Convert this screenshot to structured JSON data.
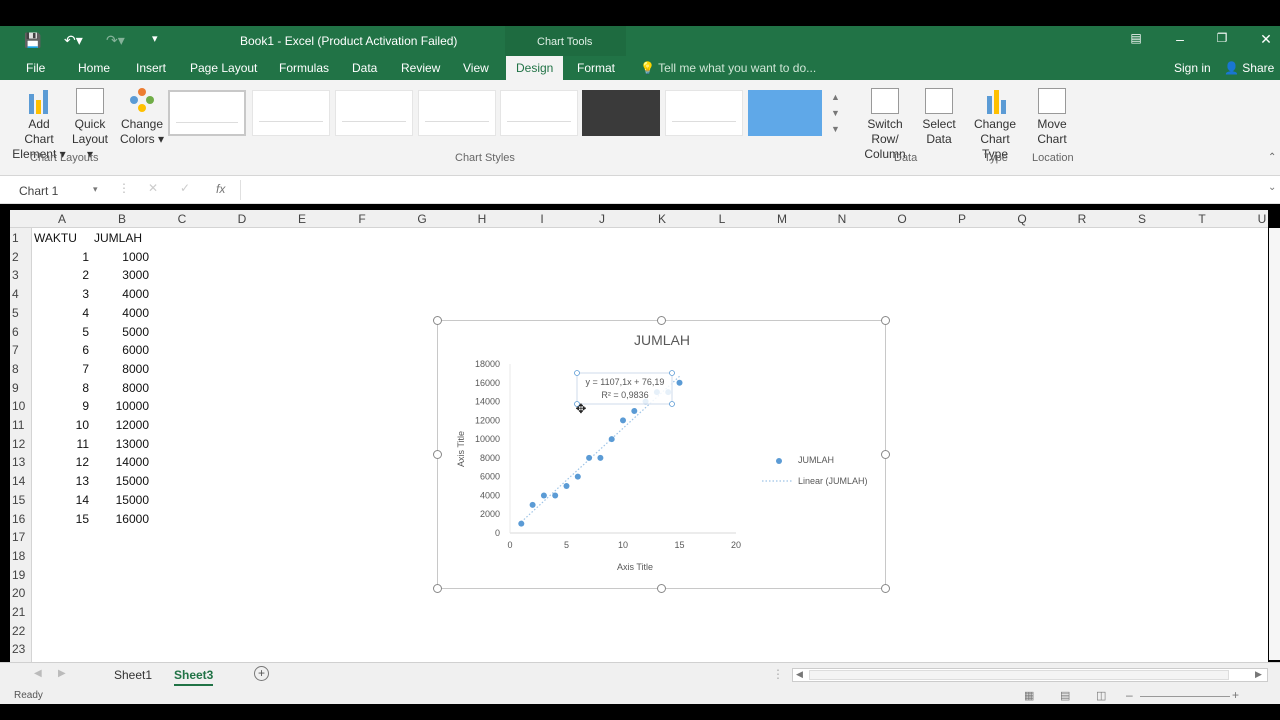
{
  "window": {
    "title": "Book1 - Excel (Product Activation Failed)",
    "context_tab_group": "Chart Tools"
  },
  "tabs": [
    "File",
    "Home",
    "Insert",
    "Page Layout",
    "Formulas",
    "Data",
    "Review",
    "View",
    "Design",
    "Format"
  ],
  "active_tab": "Design",
  "tell_me": "Tell me what you want to do...",
  "account": {
    "signin": "Sign in",
    "share": "Share"
  },
  "ribbon": {
    "add_chart_element": [
      "Add Chart",
      "Element"
    ],
    "quick_layout": [
      "Quick",
      "Layout"
    ],
    "change_colors": [
      "Change",
      "Colors"
    ],
    "switch_row_column": [
      "Switch Row/",
      "Column"
    ],
    "select_data": [
      "Select",
      "Data"
    ],
    "change_chart_type": [
      "Change",
      "Chart Type"
    ],
    "move_chart": [
      "Move",
      "Chart"
    ],
    "groups": {
      "chart_layouts": "Chart Layouts",
      "chart_styles": "Chart Styles",
      "data": "Data",
      "type": "Type",
      "location": "Location"
    }
  },
  "name_box": "Chart 1",
  "fx": "fx",
  "columns": [
    "A",
    "B",
    "C",
    "D",
    "E",
    "F",
    "G",
    "H",
    "I",
    "J",
    "K",
    "L",
    "M",
    "N",
    "O",
    "P",
    "Q",
    "R",
    "S",
    "T",
    "U"
  ],
  "rows": [
    "1",
    "2",
    "3",
    "4",
    "5",
    "6",
    "7",
    "8",
    "9",
    "10",
    "11",
    "12",
    "13",
    "14",
    "15",
    "16",
    "17",
    "18",
    "19",
    "20",
    "21",
    "22",
    "23"
  ],
  "table": {
    "headers": [
      "WAKTU",
      "JUMLAH"
    ],
    "waktu": [
      "1",
      "2",
      "3",
      "4",
      "5",
      "6",
      "7",
      "8",
      "9",
      "10",
      "11",
      "12",
      "13",
      "14",
      "15"
    ],
    "jumlah": [
      "1000",
      "3000",
      "4000",
      "4000",
      "5000",
      "6000",
      "8000",
      "8000",
      "10000",
      "12000",
      "13000",
      "14000",
      "15000",
      "15000",
      "16000"
    ]
  },
  "chart_data": {
    "type": "scatter",
    "title": "JUMLAH",
    "xlabel": "Axis Title",
    "ylabel": "Axis Title",
    "xlim": [
      0,
      20
    ],
    "ylim": [
      0,
      18000
    ],
    "x_ticks": [
      "0",
      "5",
      "10",
      "15",
      "20"
    ],
    "y_ticks": [
      "0",
      "2000",
      "4000",
      "6000",
      "8000",
      "10000",
      "12000",
      "14000",
      "16000",
      "18000"
    ],
    "x": [
      1,
      2,
      3,
      4,
      5,
      6,
      7,
      8,
      9,
      10,
      11,
      12,
      13,
      14,
      15
    ],
    "series": [
      {
        "name": "JUMLAH",
        "values": [
          1000,
          3000,
          4000,
          4000,
          5000,
          6000,
          8000,
          8000,
          10000,
          12000,
          13000,
          14000,
          15000,
          15000,
          16000
        ]
      }
    ],
    "trendline": {
      "name": "Linear (JUMLAH)",
      "slope": 1107.1,
      "intercept": 76.19
    },
    "equation_label": [
      "y = 1107,1x + 76,19",
      "R² = 0,9836"
    ],
    "legend": [
      "JUMLAH",
      "Linear (JUMLAH)"
    ],
    "legend_position": "right",
    "colors": {
      "marker": "#5b9bd5",
      "trend": "#9dc3e6"
    }
  },
  "sheets": [
    "Sheet1",
    "Sheet3"
  ],
  "active_sheet": "Sheet3",
  "status": "Ready",
  "colors": {
    "excel_green": "#217346"
  }
}
